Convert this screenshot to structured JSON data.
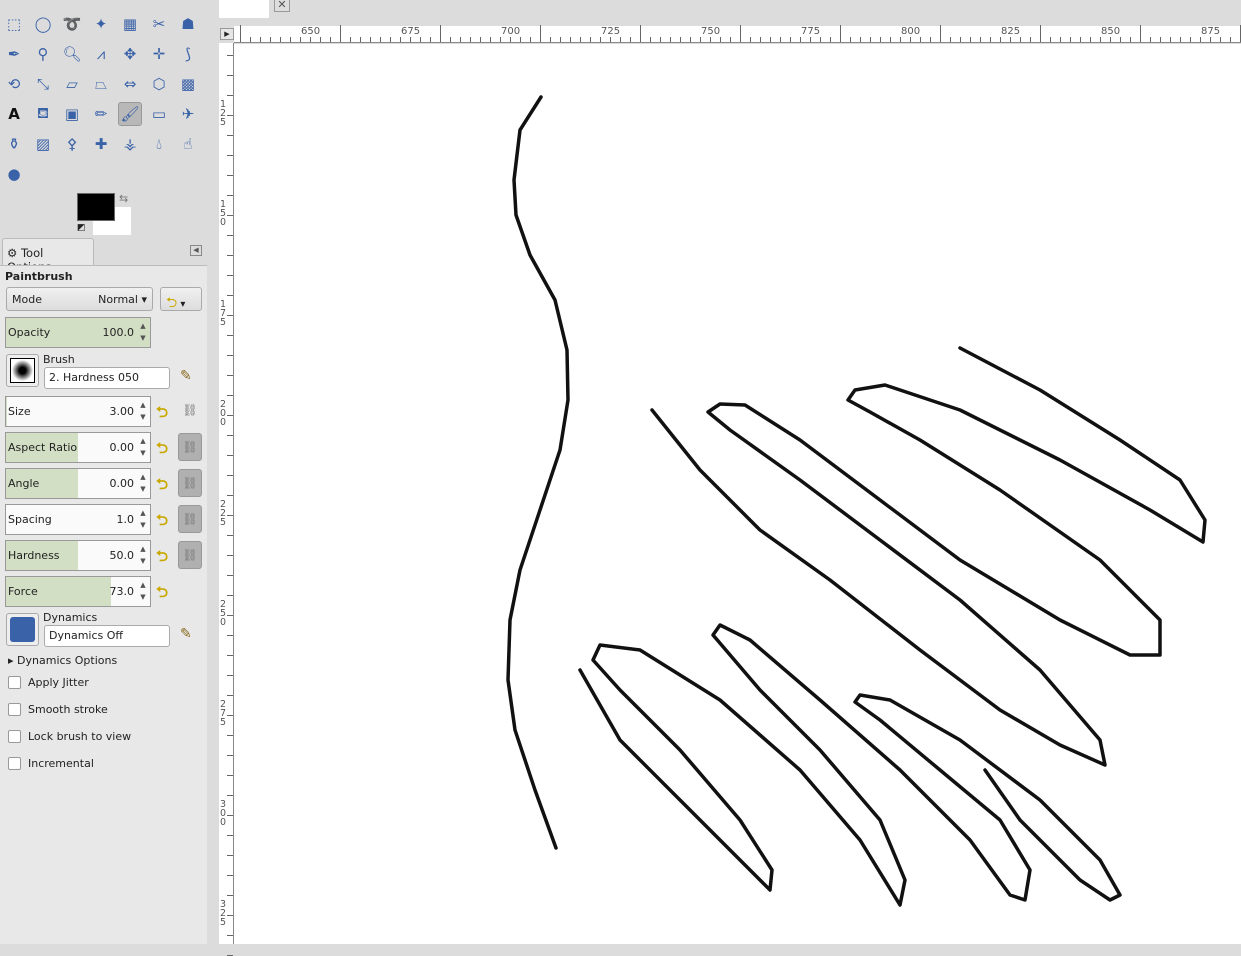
{
  "toolbox": {
    "tools": [
      "rect-select",
      "ellipse-select",
      "free-select",
      "fuzzy-select",
      "select-by-color",
      "scissors-select",
      "foreground-select",
      "paths",
      "color-picker",
      "zoom",
      "measure",
      "move",
      "align",
      "crop",
      "rotate",
      "scale",
      "shear",
      "perspective",
      "flip",
      "cage-transform",
      "warp",
      "text",
      "bucket-fill",
      "blend",
      "pencil",
      "paintbrush",
      "eraser",
      "airbrush",
      "ink",
      "mypaint-brush",
      "clone",
      "heal",
      "perspective-clone",
      "blur-sharpen",
      "smudge",
      "dodge-burn"
    ],
    "active_tool": "paintbrush",
    "fg_color": "#000000",
    "bg_color": "#ffffff"
  },
  "tool_options": {
    "tab_label": "Tool Options",
    "title": "Paintbrush",
    "mode_label": "Mode",
    "mode_value": "Normal",
    "opacity": {
      "label": "Opacity",
      "value": "100.0",
      "fraction": 1.0
    },
    "brush_label": "Brush",
    "brush_value": "2. Hardness 050",
    "sliders": [
      {
        "label": "Size",
        "value": "3.00",
        "fraction": 0.01
      },
      {
        "label": "Aspect Ratio",
        "value": "0.00",
        "fraction": 0.5
      },
      {
        "label": "Angle",
        "value": "0.00",
        "fraction": 0.5
      },
      {
        "label": "Spacing",
        "value": "1.0",
        "fraction": 0.0
      },
      {
        "label": "Hardness",
        "value": "50.0",
        "fraction": 0.5
      },
      {
        "label": "Force",
        "value": "73.0",
        "fraction": 0.73
      }
    ],
    "dynamics_label": "Dynamics",
    "dynamics_value": "Dynamics Off",
    "dynamics_options": "Dynamics Options",
    "checkboxes": [
      {
        "label": "Apply Jitter",
        "checked": false
      },
      {
        "label": "Smooth stroke",
        "checked": false
      },
      {
        "label": "Lock brush to view",
        "checked": false
      },
      {
        "label": "Incremental",
        "checked": false
      }
    ]
  },
  "rulers": {
    "h": [
      "650",
      "675",
      "700",
      "725",
      "750",
      "775",
      "800",
      "825",
      "850",
      "875"
    ],
    "v": [
      "125",
      "150",
      "175",
      "200",
      "225",
      "250",
      "275",
      "300",
      "325"
    ]
  }
}
